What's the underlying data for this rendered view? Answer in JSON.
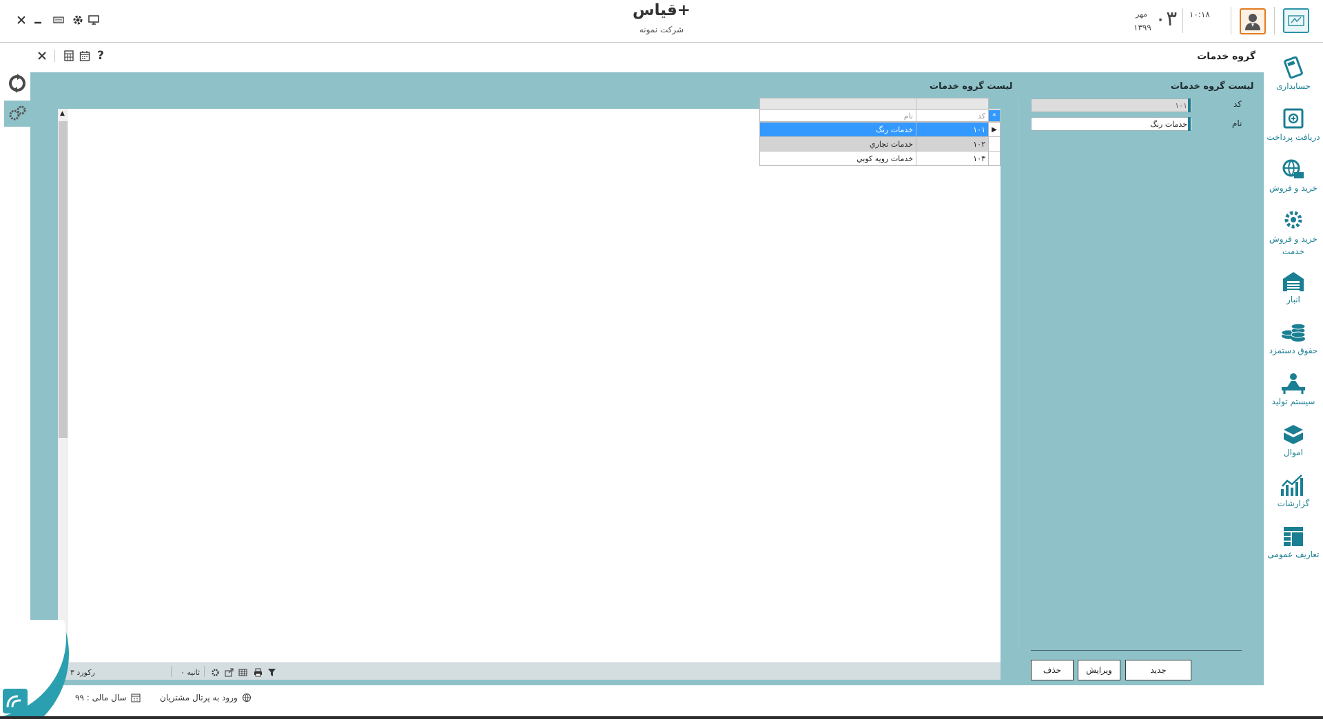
{
  "window": {
    "app_title": "قیاس+",
    "company": "شرکت نمونه",
    "time": "۱۰:۱۸",
    "day": "۰۳",
    "month": "مهر",
    "year": "۱۳۹۹"
  },
  "form": {
    "title": "گروه خدمات",
    "left_panel_title": "لیست گروه خدمات",
    "right_panel_title": "لیست گروه خدمات",
    "code_label": "کد",
    "name_label": "نام",
    "code_value": "۱۰۱",
    "name_value": "خدمات رنگ",
    "buttons": {
      "new": "جدید",
      "edit": "ویرایش",
      "delete": "حذف"
    }
  },
  "grid": {
    "col_code": "کد",
    "col_name": "نام",
    "rows": [
      {
        "code": "۱۰۱",
        "name": "خدمات رنگ"
      },
      {
        "code": "۱۰۲",
        "name": "خدمات تجاري"
      },
      {
        "code": "۱۰۳",
        "name": "خدمات رویه کوبي"
      }
    ]
  },
  "status": {
    "records": "۳ رکورد",
    "seconds": "۰ ثانیه"
  },
  "footer": {
    "fiscal_year": "سال مالی : ۹۹",
    "portal": "ورود به پرتال مشتریان"
  },
  "sidebar": [
    {
      "label": "حسابداری",
      "icon": "calculator-icon"
    },
    {
      "label": "دریافت پرداخت",
      "icon": "safe-icon"
    },
    {
      "label": "خرید و فروش",
      "icon": "globe-cart-icon"
    },
    {
      "label": "خرید و فروش خدمت",
      "icon": "gear-wrench-icon"
    },
    {
      "label": "انبار",
      "icon": "warehouse-icon"
    },
    {
      "label": "حقوق دستمزد",
      "icon": "coins-icon"
    },
    {
      "label": "سیستم تولید",
      "icon": "factory-worker-icon"
    },
    {
      "label": "اموال",
      "icon": "box-icon"
    },
    {
      "label": "گزارشات",
      "icon": "chart-icon"
    },
    {
      "label": "تعاریف عمومی",
      "icon": "table-icon"
    }
  ],
  "colors": {
    "teal_bg": "#8fc1c8",
    "accent": "#1a7f93",
    "selection": "#3399ff"
  }
}
